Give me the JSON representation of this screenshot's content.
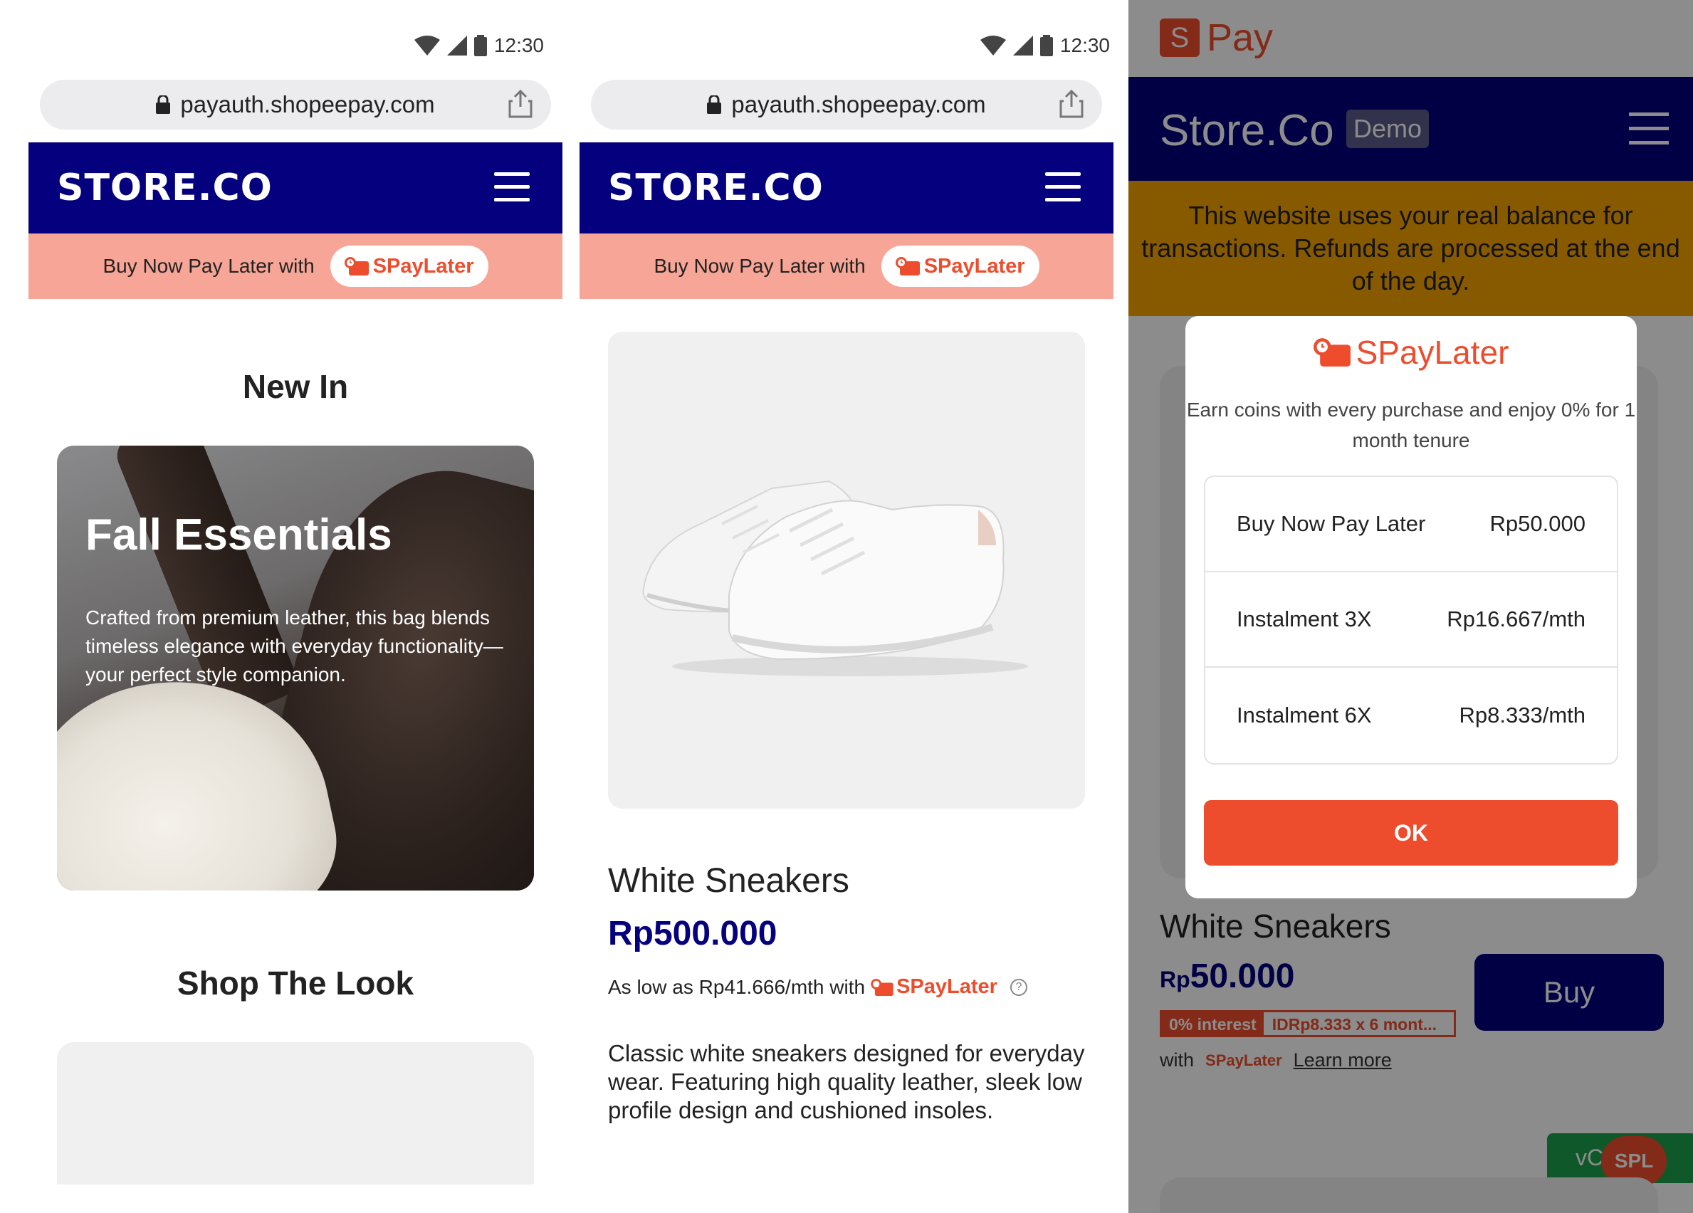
{
  "status_bar": {
    "time": "12:30"
  },
  "browser": {
    "url": "payauth.shopeepay.com"
  },
  "store": {
    "logo": "STORE.CO"
  },
  "promo": {
    "text": "Buy Now Pay Later with",
    "badge": "SPayLater"
  },
  "screen1": {
    "new_in": "New In",
    "card": {
      "title": "Fall Essentials",
      "description": "Crafted from premium leather, this bag blends timeless elegance with everyday functionality—your perfect style companion."
    },
    "shop_the_look": "Shop The Look"
  },
  "screen2": {
    "product_name": "White Sneakers",
    "price": "Rp500.000",
    "installment_prefix": "As low as Rp41.666/mth with",
    "installment_brand": "SPayLater",
    "help_icon": "?",
    "description": "Classic white sneakers designed for everyday wear. Featuring high quality leather, sleek low profile design and cushioned insoles."
  },
  "screen3": {
    "spay_icon_letter": "S",
    "spay_logo": "Pay",
    "header_title": "Store.Co",
    "demo_badge": "Demo",
    "warning": "This website uses your real balance for transactions. Refunds are processed at the end of the day.",
    "product_name": "White Sneakers",
    "price_prefix": "Rp",
    "price": "50.000",
    "interest_badge": "0% interest",
    "interest_detail": "IDRp8.333 x 6 mont...",
    "with_label": "with",
    "with_brand": "SPayLater",
    "learn_more": "Learn more",
    "buy_button": "Buy",
    "vc_button": "vC",
    "spl_fab": "SPL",
    "modal": {
      "brand": "SPayLater",
      "subtitle": "Earn coins with every purchase and enjoy 0% for 1 month tenure",
      "rows": [
        {
          "label": "Buy Now Pay Later",
          "value": "Rp50.000"
        },
        {
          "label": "Instalment 3X",
          "value": "Rp16.667/mth"
        },
        {
          "label": "Instalment 6X",
          "value": "Rp8.333/mth"
        }
      ],
      "ok": "OK"
    }
  },
  "colors": {
    "navy": "#05007e",
    "shopee_orange": "#ee4d2d",
    "promo_salmon": "#f7a596",
    "warning_amber": "#f7a400"
  }
}
